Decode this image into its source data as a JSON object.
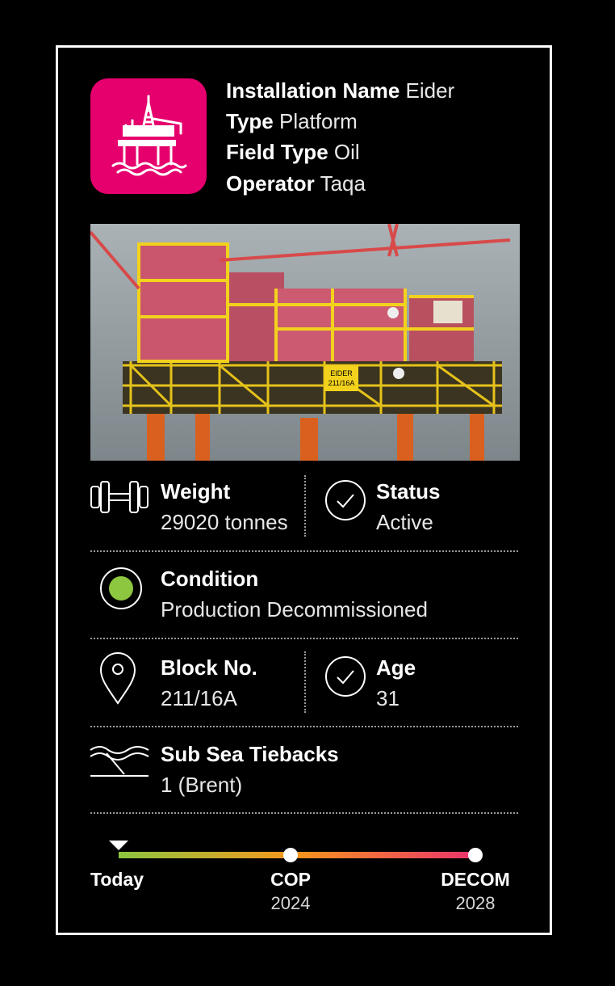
{
  "header": {
    "fields": [
      {
        "label": "Installation Name",
        "value": "Eider"
      },
      {
        "label": "Type",
        "value": "Platform"
      },
      {
        "label": "Field Type",
        "value": "Oil"
      },
      {
        "label": "Operator",
        "value": "Taqa"
      }
    ],
    "icon": "oil-platform-icon",
    "icon_color": "#e5006d"
  },
  "photo": {
    "sign_text_1": "EIDER",
    "sign_text_2": "211/16A"
  },
  "weight": {
    "label": "Weight",
    "value": "29020 tonnes",
    "icon": "dumbbell-icon"
  },
  "status": {
    "label": "Status",
    "value": "Active",
    "icon": "check-circle-icon"
  },
  "condition": {
    "label": "Condition",
    "value": "Production Decommissioned",
    "indicator_color": "#8dc63f"
  },
  "block": {
    "label": "Block No.",
    "value": "211/16A",
    "icon": "map-pin-icon"
  },
  "age": {
    "label": "Age",
    "value": "31",
    "icon": "check-circle-icon"
  },
  "tiebacks": {
    "label": "Sub Sea Tiebacks",
    "value": "1 (Brent)",
    "icon": "waves-icon"
  },
  "timeline": {
    "gradient": [
      "#8dc63f",
      "#f7941d",
      "#e8336d"
    ],
    "points": [
      {
        "label": "Today",
        "year": ""
      },
      {
        "label": "COP",
        "year": "2024"
      },
      {
        "label": "DECOM",
        "year": "2028"
      }
    ]
  }
}
